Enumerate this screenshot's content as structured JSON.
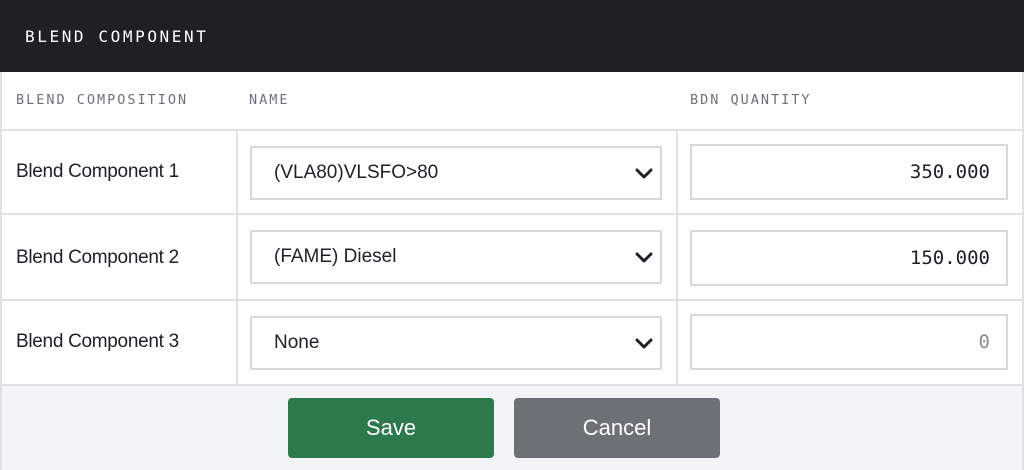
{
  "modal": {
    "title": "BLEND COMPONENT"
  },
  "table": {
    "headers": {
      "composition": "BLEND COMPOSITION",
      "name": "NAME",
      "quantity": "BDN QUANTITY"
    },
    "rows": [
      {
        "label": "Blend Component 1",
        "name": "(VLA80)VLSFO>80",
        "quantity": "350.000",
        "quantity_is_placeholder": false
      },
      {
        "label": "Blend Component 2",
        "name": "(FAME) Diesel",
        "quantity": "150.000",
        "quantity_is_placeholder": false
      },
      {
        "label": "Blend Component 3",
        "name": "None",
        "quantity": "0",
        "quantity_is_placeholder": true
      }
    ]
  },
  "actions": {
    "save_label": "Save",
    "cancel_label": "Cancel"
  },
  "colors": {
    "header_bg": "#1d2024",
    "save": "#2c7a4b",
    "cancel": "#6c7178"
  },
  "icons": {
    "select_arrow": "chevron-down-icon"
  }
}
